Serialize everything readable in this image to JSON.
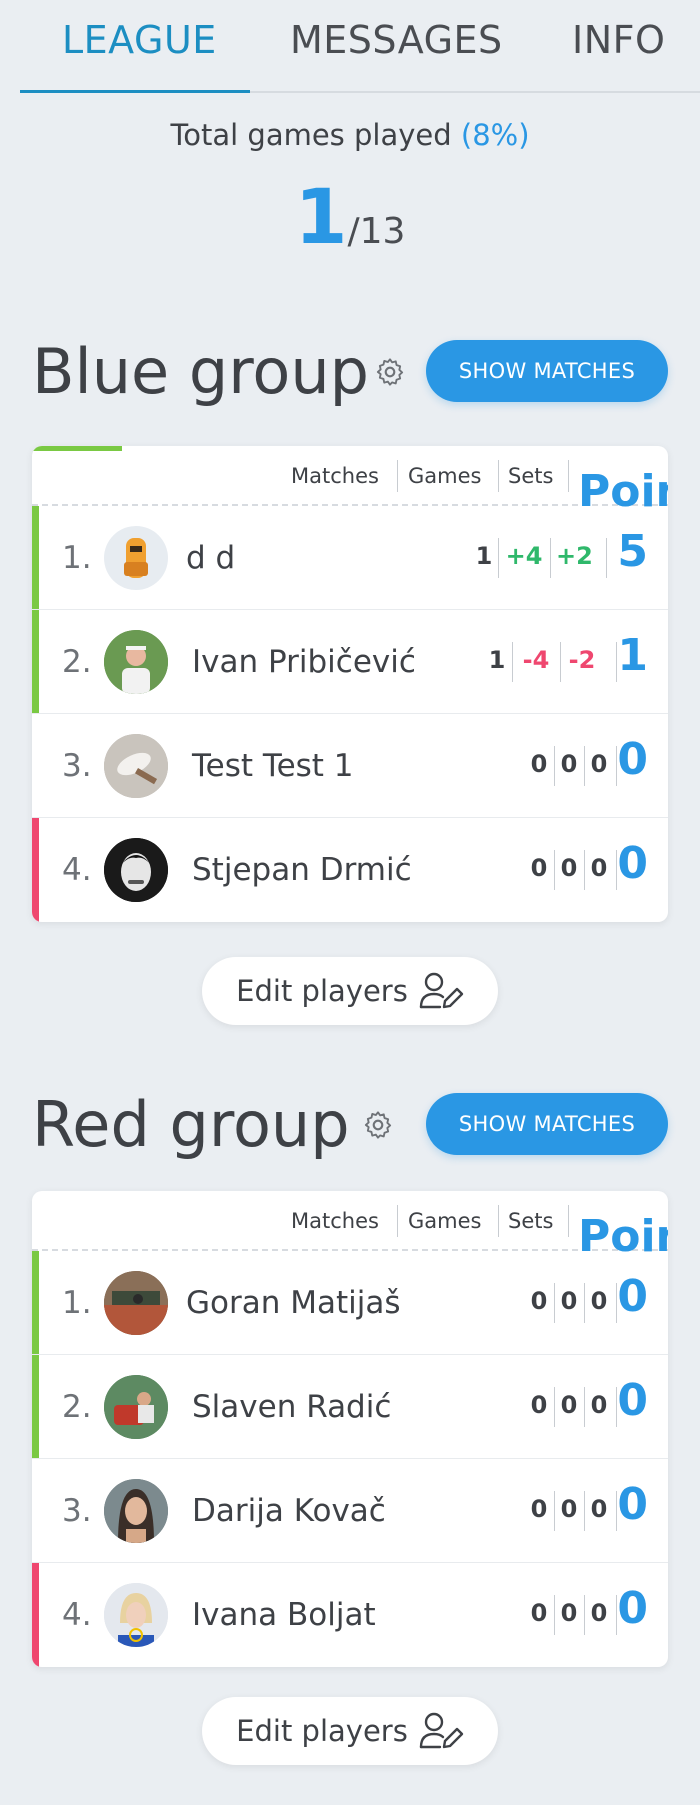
{
  "tabs": [
    {
      "label": "LEAGUE",
      "active": true
    },
    {
      "label": "MESSAGES",
      "active": false
    },
    {
      "label": "INFO",
      "active": false
    }
  ],
  "summary": {
    "label": "Total games played",
    "percent": "(8%)",
    "played": "1",
    "total": "/13"
  },
  "table_headers": {
    "matches": "Matches",
    "games": "Games",
    "sets": "Sets",
    "points": "Points"
  },
  "groups": [
    {
      "title": "Blue group",
      "show_matches_label": "SHOW MATCHES",
      "edit_players_label": "Edit players",
      "progress_fraction": 0.08,
      "players": [
        {
          "rank": "1.",
          "name": "d d",
          "matches": "1",
          "games": "+4",
          "sets": "+2",
          "points": "5",
          "status": "promote"
        },
        {
          "rank": "2.",
          "name": "Ivan Pribičević",
          "matches": "1",
          "games": "-4",
          "sets": "-2",
          "points": "1",
          "status": "promote"
        },
        {
          "rank": "3.",
          "name": "Test Test 1",
          "matches": "0",
          "games": "0",
          "sets": "0",
          "points": "0",
          "status": "none"
        },
        {
          "rank": "4.",
          "name": "Stjepan Drmić",
          "matches": "0",
          "games": "0",
          "sets": "0",
          "points": "0",
          "status": "relegate"
        }
      ]
    },
    {
      "title": "Red group",
      "show_matches_label": "SHOW MATCHES",
      "edit_players_label": "Edit players",
      "progress_fraction": 0,
      "players": [
        {
          "rank": "1.",
          "name": "Goran Matijaš",
          "matches": "0",
          "games": "0",
          "sets": "0",
          "points": "0",
          "status": "promote"
        },
        {
          "rank": "2.",
          "name": "Slaven Radić",
          "matches": "0",
          "games": "0",
          "sets": "0",
          "points": "0",
          "status": "promote"
        },
        {
          "rank": "3.",
          "name": "Darija Kovač",
          "matches": "0",
          "games": "0",
          "sets": "0",
          "points": "0",
          "status": "none"
        },
        {
          "rank": "4.",
          "name": "Ivana Boljat",
          "matches": "0",
          "games": "0",
          "sets": "0",
          "points": "0",
          "status": "relegate"
        }
      ]
    }
  ],
  "colors": {
    "accent": "#2a97e4",
    "tab_active": "#1c8ec2",
    "promote": "#7ac943",
    "relegate": "#ef476f",
    "positive": "#2fb86b",
    "negative": "#ef476f"
  },
  "icons": {
    "settings": "gear-icon",
    "edit_players": "user-edit-icon"
  }
}
